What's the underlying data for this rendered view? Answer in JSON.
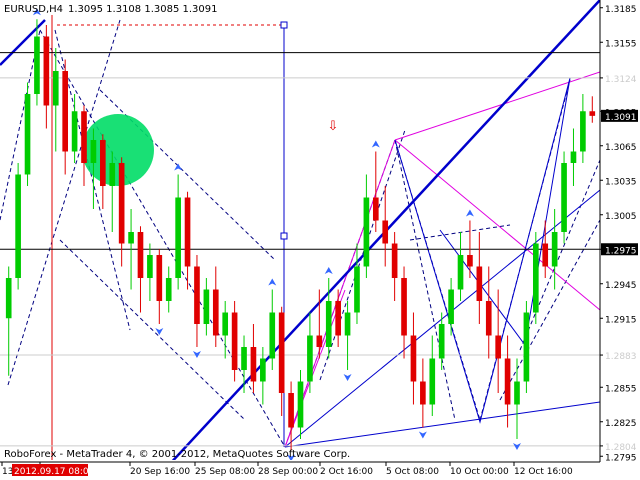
{
  "header": {
    "symbol": "EURUSD,H4",
    "ohlc": "1.3095 1.3108 1.3085 1.3091"
  },
  "footer": {
    "copyright": "RoboForex - MetaTrader 4, © 2001-2012, MetaQuotes Software Corp."
  },
  "colors": {
    "background": "#ffffff",
    "bull_candle": "#00cc00",
    "bear_candle": "#e00000",
    "trend_blue": "#0000cc",
    "fan_magenta": "#e000e0",
    "wave_dashed": "#000080",
    "arrow_blue": "#3366ff",
    "circle_green": "#00dd66",
    "axis_text": "#000000",
    "price_label_bg": "#000000",
    "price_label_fg": "#ffffff",
    "faint_level": "#cccccc"
  },
  "chart_data": {
    "type": "candlestick",
    "ylim": [
      1.279,
      1.319
    ],
    "y_ticks": [
      "1.3185",
      "1.3155",
      "1.3124",
      "1.3095",
      "1.3065",
      "1.3035",
      "1.3005",
      "1.2975",
      "1.2945",
      "1.2915",
      "1.2883",
      "1.2855",
      "1.2825",
      "1.2804",
      "1.2795"
    ],
    "x_ticks": [
      "13 ...",
      "2012.09.17 08:00",
      "20 Sep 16:00",
      "25 Sep 08:00",
      "28 Sep 00:00",
      "2 Oct 16:00",
      "5 Oct 08:00",
      "10 Oct 00:00",
      "12 Oct 16:00"
    ],
    "horizontal_levels": [
      {
        "price": 1.3146,
        "label": "1.3146",
        "style": "solid-black",
        "highlight": true
      },
      {
        "price": 1.2975,
        "label": "1.2975",
        "style": "solid-black",
        "highlight": true
      },
      {
        "price": 1.3124,
        "label": "1.3124",
        "style": "faint",
        "highlight": false
      },
      {
        "price": 1.2883,
        "label": "1.2883",
        "style": "faint",
        "highlight": false
      },
      {
        "price": 1.2804,
        "label": "1.2804",
        "style": "faint",
        "highlight": false
      }
    ],
    "current_price": {
      "price": 1.3091,
      "label": "1.3091"
    },
    "ohlc": [
      [
        1.2915,
        1.296,
        1.2865,
        1.295
      ],
      [
        1.295,
        1.305,
        1.294,
        1.304
      ],
      [
        1.304,
        1.312,
        1.303,
        1.311
      ],
      [
        1.311,
        1.3175,
        1.31,
        1.316
      ],
      [
        1.316,
        1.317,
        1.308,
        1.31
      ],
      [
        1.31,
        1.315,
        1.306,
        1.313
      ],
      [
        1.313,
        1.314,
        1.304,
        1.306
      ],
      [
        1.306,
        1.311,
        1.305,
        1.3095
      ],
      [
        1.3095,
        1.31,
        1.303,
        1.305
      ],
      [
        1.305,
        1.308,
        1.301,
        1.307
      ],
      [
        1.307,
        1.3075,
        1.301,
        1.303
      ],
      [
        1.303,
        1.306,
        1.299,
        1.305
      ],
      [
        1.305,
        1.3055,
        1.296,
        1.298
      ],
      [
        1.298,
        1.301,
        1.294,
        1.299
      ],
      [
        1.299,
        1.2995,
        1.292,
        1.295
      ],
      [
        1.295,
        1.298,
        1.293,
        1.297
      ],
      [
        1.297,
        1.2975,
        1.291,
        1.293
      ],
      [
        1.293,
        1.296,
        1.292,
        1.295
      ],
      [
        1.295,
        1.304,
        1.294,
        1.302
      ],
      [
        1.302,
        1.3025,
        1.294,
        1.296
      ],
      [
        1.296,
        1.297,
        1.289,
        1.291
      ],
      [
        1.291,
        1.295,
        1.29,
        1.294
      ],
      [
        1.294,
        1.296,
        1.289,
        1.29
      ],
      [
        1.29,
        1.293,
        1.288,
        1.292
      ],
      [
        1.292,
        1.293,
        1.286,
        1.287
      ],
      [
        1.287,
        1.29,
        1.285,
        1.289
      ],
      [
        1.289,
        1.291,
        1.285,
        1.286
      ],
      [
        1.286,
        1.289,
        1.284,
        1.288
      ],
      [
        1.288,
        1.294,
        1.287,
        1.292
      ],
      [
        1.292,
        1.2925,
        1.283,
        1.285
      ],
      [
        1.285,
        1.286,
        1.28,
        1.282
      ],
      [
        1.282,
        1.287,
        1.281,
        1.286
      ],
      [
        1.286,
        1.292,
        1.285,
        1.29
      ],
      [
        1.29,
        1.294,
        1.288,
        1.289
      ],
      [
        1.289,
        1.295,
        1.288,
        1.293
      ],
      [
        1.293,
        1.294,
        1.289,
        1.29
      ],
      [
        1.29,
        1.293,
        1.287,
        1.292
      ],
      [
        1.292,
        1.298,
        1.291,
        1.296
      ],
      [
        1.296,
        1.304,
        1.295,
        1.302
      ],
      [
        1.302,
        1.306,
        1.299,
        1.3
      ],
      [
        1.3,
        1.303,
        1.296,
        1.298
      ],
      [
        1.298,
        1.299,
        1.293,
        1.295
      ],
      [
        1.295,
        1.296,
        1.288,
        1.29
      ],
      [
        1.29,
        1.292,
        1.284,
        1.286
      ],
      [
        1.286,
        1.288,
        1.282,
        1.284
      ],
      [
        1.284,
        1.29,
        1.283,
        1.288
      ],
      [
        1.288,
        1.292,
        1.287,
        1.291
      ],
      [
        1.291,
        1.295,
        1.29,
        1.294
      ],
      [
        1.294,
        1.299,
        1.293,
        1.297
      ],
      [
        1.297,
        1.3,
        1.295,
        1.296
      ],
      [
        1.296,
        1.299,
        1.291,
        1.293
      ],
      [
        1.293,
        1.296,
        1.288,
        1.29
      ],
      [
        1.29,
        1.294,
        1.285,
        1.288
      ],
      [
        1.288,
        1.29,
        1.282,
        1.284
      ],
      [
        1.284,
        1.288,
        1.281,
        1.286
      ],
      [
        1.286,
        1.293,
        1.285,
        1.292
      ],
      [
        1.292,
        1.299,
        1.291,
        1.298
      ],
      [
        1.298,
        1.3,
        1.295,
        1.296
      ],
      [
        1.296,
        1.301,
        1.294,
        1.299
      ],
      [
        1.299,
        1.306,
        1.298,
        1.305
      ],
      [
        1.305,
        1.308,
        1.303,
        1.306
      ],
      [
        1.306,
        1.311,
        1.305,
        1.3095
      ],
      [
        1.3095,
        1.3108,
        1.3085,
        1.3091
      ]
    ]
  }
}
